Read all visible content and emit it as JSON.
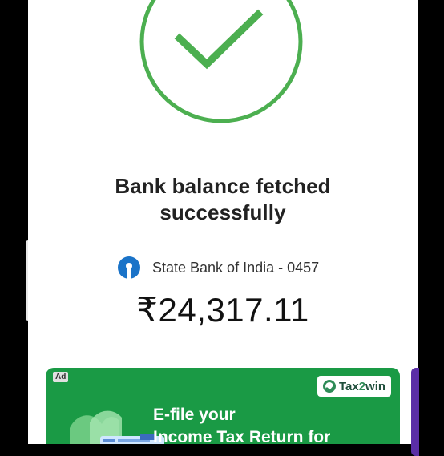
{
  "status": {
    "title_line1": "Bank balance fetched",
    "title_line2": "successfully"
  },
  "account": {
    "bank_label": "State Bank of India - 0457",
    "balance": "₹24,317.11"
  },
  "ad": {
    "badge": "Ad",
    "brand_prefix": "Tax",
    "brand_num": "2",
    "brand_suffix": "win",
    "headline_line1": "E-file your",
    "headline_line2": "Income Tax Return for"
  },
  "colors": {
    "success_green": "#4caf50",
    "ad_green": "#1a9a45",
    "bank_blue": "#1a73c8"
  },
  "icons": {
    "status": "check-circle-icon",
    "bank": "sbi-logo-icon"
  }
}
